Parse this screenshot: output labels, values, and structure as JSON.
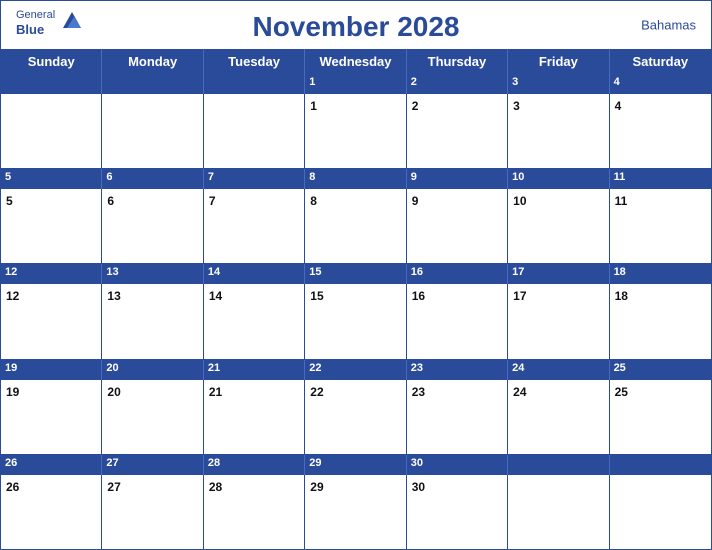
{
  "header": {
    "logo_general": "General",
    "logo_blue": "Blue",
    "title": "November 2028",
    "country": "Bahamas"
  },
  "day_headers": [
    "Sunday",
    "Monday",
    "Tuesday",
    "Wednesday",
    "Thursday",
    "Friday",
    "Saturday"
  ],
  "weeks": [
    {
      "days": [
        {
          "num": "",
          "empty": true
        },
        {
          "num": "",
          "empty": true
        },
        {
          "num": "",
          "empty": true
        },
        {
          "num": "1",
          "empty": false
        },
        {
          "num": "2",
          "empty": false
        },
        {
          "num": "3",
          "empty": false
        },
        {
          "num": "4",
          "empty": false
        }
      ]
    },
    {
      "days": [
        {
          "num": "5",
          "empty": false
        },
        {
          "num": "6",
          "empty": false
        },
        {
          "num": "7",
          "empty": false
        },
        {
          "num": "8",
          "empty": false
        },
        {
          "num": "9",
          "empty": false
        },
        {
          "num": "10",
          "empty": false
        },
        {
          "num": "11",
          "empty": false
        }
      ]
    },
    {
      "days": [
        {
          "num": "12",
          "empty": false
        },
        {
          "num": "13",
          "empty": false
        },
        {
          "num": "14",
          "empty": false
        },
        {
          "num": "15",
          "empty": false
        },
        {
          "num": "16",
          "empty": false
        },
        {
          "num": "17",
          "empty": false
        },
        {
          "num": "18",
          "empty": false
        }
      ]
    },
    {
      "days": [
        {
          "num": "19",
          "empty": false
        },
        {
          "num": "20",
          "empty": false
        },
        {
          "num": "21",
          "empty": false
        },
        {
          "num": "22",
          "empty": false
        },
        {
          "num": "23",
          "empty": false
        },
        {
          "num": "24",
          "empty": false
        },
        {
          "num": "25",
          "empty": false
        }
      ]
    },
    {
      "days": [
        {
          "num": "26",
          "empty": false
        },
        {
          "num": "27",
          "empty": false
        },
        {
          "num": "28",
          "empty": false
        },
        {
          "num": "29",
          "empty": false
        },
        {
          "num": "30",
          "empty": false
        },
        {
          "num": "",
          "empty": true
        },
        {
          "num": "",
          "empty": true
        }
      ]
    }
  ],
  "colors": {
    "primary_blue": "#2a4a9a",
    "header_blue": "#1e3a8a",
    "border_blue": "#2a4a9a"
  }
}
